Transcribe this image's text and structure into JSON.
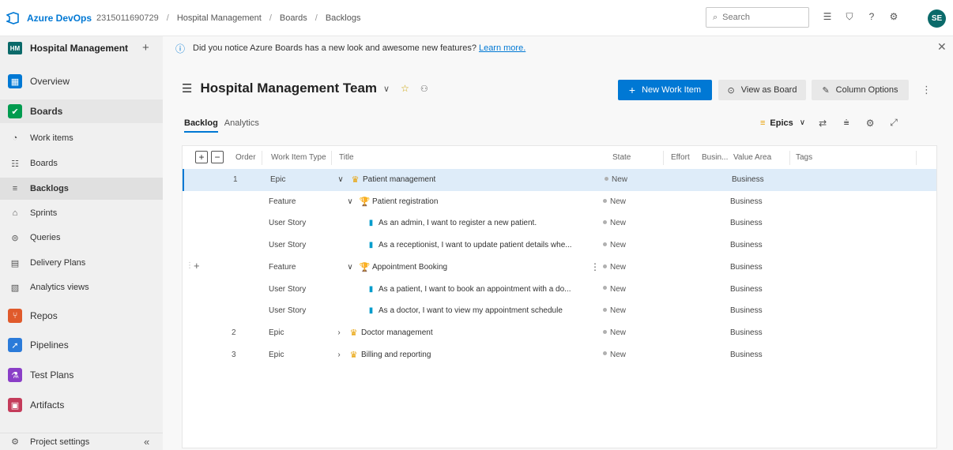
{
  "topbar": {
    "brand": "Azure DevOps",
    "org": "2315011690729",
    "breadcrumbs": [
      "Hospital Management",
      "Boards",
      "Backlogs"
    ],
    "search_placeholder": "Search",
    "avatar_initials": "SE"
  },
  "sidebar": {
    "project_badge": "HM",
    "project_name": "Hospital Management",
    "items": [
      {
        "label": "Overview",
        "icon": "overview-icon",
        "color": "#0078d4"
      },
      {
        "label": "Boards",
        "icon": "boards-icon",
        "color": "#009b4f"
      },
      {
        "label": "Work items",
        "icon": "work-items-icon"
      },
      {
        "label": "Boards",
        "icon": "kanban-icon"
      },
      {
        "label": "Backlogs",
        "icon": "backlogs-icon"
      },
      {
        "label": "Sprints",
        "icon": "sprints-icon"
      },
      {
        "label": "Queries",
        "icon": "queries-icon"
      },
      {
        "label": "Delivery Plans",
        "icon": "delivery-plans-icon"
      },
      {
        "label": "Analytics views",
        "icon": "analytics-views-icon"
      },
      {
        "label": "Repos",
        "icon": "repos-icon",
        "color": "#e05a2b"
      },
      {
        "label": "Pipelines",
        "icon": "pipelines-icon",
        "color": "#2b7bd9"
      },
      {
        "label": "Test Plans",
        "icon": "test-plans-icon",
        "color": "#8a3ec7"
      },
      {
        "label": "Artifacts",
        "icon": "artifacts-icon",
        "color": "#c43b5a"
      }
    ],
    "settings_label": "Project settings"
  },
  "banner": {
    "text": "Did you notice Azure Boards has a new look and awesome new features?",
    "link": "Learn more."
  },
  "header": {
    "team_name": "Hospital Management Team",
    "new_work_item": "New Work Item",
    "view_as_board": "View as Board",
    "column_options": "Column Options"
  },
  "tabs": [
    "Backlog",
    "Analytics"
  ],
  "toolbar": {
    "level": "Epics"
  },
  "grid": {
    "columns": [
      "Order",
      "Work Item Type",
      "Title",
      "State",
      "Effort",
      "Busin...",
      "Value Area",
      "Tags"
    ],
    "rows": [
      {
        "order": "1",
        "type": "Epic",
        "title": "Patient management",
        "state": "New",
        "area": "Business",
        "level": 0,
        "expand": "down",
        "icon": "crown-icon"
      },
      {
        "order": "",
        "type": "Feature",
        "title": "Patient registration",
        "state": "New",
        "area": "Business",
        "level": 1,
        "expand": "down",
        "icon": "trophy-icon"
      },
      {
        "order": "",
        "type": "User Story",
        "title": "As an admin, I want to register a new patient.",
        "state": "New",
        "area": "Business",
        "level": 2,
        "expand": "",
        "icon": "book-icon"
      },
      {
        "order": "",
        "type": "User Story",
        "title": "As a receptionist, I want to update patient details whe...",
        "state": "New",
        "area": "Business",
        "level": 2,
        "expand": "",
        "icon": "book-icon"
      },
      {
        "order": "",
        "type": "Feature",
        "title": "Appointment Booking",
        "state": "New",
        "area": "Business",
        "level": 1,
        "expand": "down",
        "icon": "trophy-icon"
      },
      {
        "order": "",
        "type": "User Story",
        "title": "As a patient, I want to book an appointment with a do...",
        "state": "New",
        "area": "Business",
        "level": 2,
        "expand": "",
        "icon": "book-icon"
      },
      {
        "order": "",
        "type": "User Story",
        "title": "As a doctor, I want to view my appointment schedule",
        "state": "New",
        "area": "Business",
        "level": 2,
        "expand": "",
        "icon": "book-icon"
      },
      {
        "order": "2",
        "type": "Epic",
        "title": "Doctor management",
        "state": "New",
        "area": "Business",
        "level": 0,
        "expand": "right",
        "icon": "crown-icon"
      },
      {
        "order": "3",
        "type": "Epic",
        "title": "Billing and reporting",
        "state": "New",
        "area": "Business",
        "level": 0,
        "expand": "right",
        "icon": "crown-icon"
      }
    ]
  },
  "colors": {
    "accent": "#0078d4",
    "epic": "#e8a000",
    "feature": "#773b93",
    "story": "#009ccc",
    "selected_row": "#deecf9"
  }
}
